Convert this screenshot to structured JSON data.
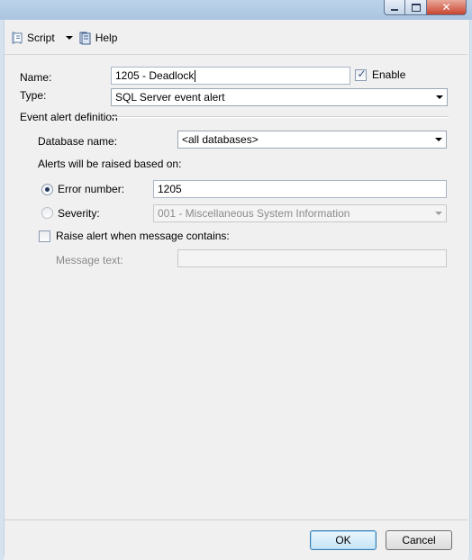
{
  "window": {
    "controls": {
      "minimize_icon": "minimize-icon",
      "maximize_icon": "maximize-icon",
      "close_icon": "close-icon",
      "close_glyph": "✕"
    }
  },
  "toolbar": {
    "script_label": "Script",
    "help_label": "Help"
  },
  "form": {
    "name_label": "Name:",
    "name_value": "1205 - Deadlock",
    "enable_label": "Enable",
    "enable_checked": true,
    "type_label": "Type:",
    "type_value": "SQL Server event alert",
    "group_label": "Event alert definition",
    "database_label": "Database name:",
    "database_value": "<all databases>",
    "raised_label": "Alerts will be raised based on:",
    "error_number_label": "Error number:",
    "error_number_value": "1205",
    "error_number_selected": true,
    "severity_label": "Severity:",
    "severity_value": "001 - Miscellaneous System Information",
    "raise_alert_label": "Raise alert when message contains:",
    "raise_alert_checked": false,
    "message_text_label": "Message text:",
    "message_text_value": ""
  },
  "buttons": {
    "ok_label": "OK",
    "cancel_label": "Cancel"
  },
  "colors": {
    "accent": "#3c7fb1",
    "close_red": "#c8452e"
  }
}
